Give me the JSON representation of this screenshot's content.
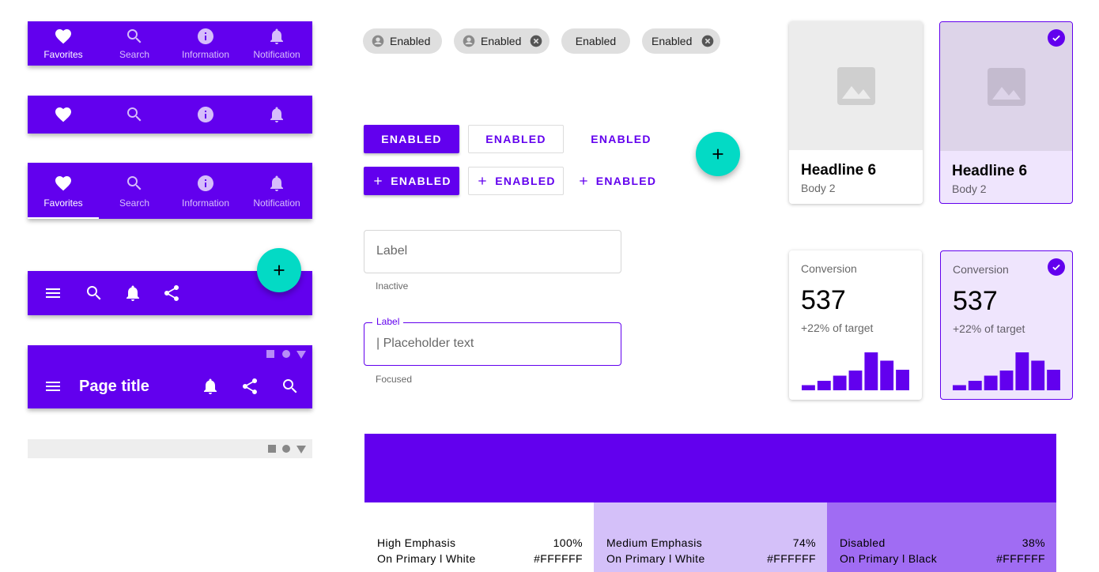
{
  "bottom_nav_labeled": {
    "items": [
      {
        "label": "Favorites",
        "icon": "heart-icon",
        "active": true
      },
      {
        "label": "Search",
        "icon": "search-icon",
        "active": false
      },
      {
        "label": "Information",
        "icon": "info-icon",
        "active": false
      },
      {
        "label": "Notification",
        "icon": "bell-icon",
        "active": false
      }
    ]
  },
  "bottom_nav_icons": {
    "items": [
      {
        "icon": "heart-icon"
      },
      {
        "icon": "search-icon"
      },
      {
        "icon": "info-icon"
      },
      {
        "icon": "bell-icon"
      }
    ]
  },
  "bottom_nav_tabs": {
    "items": [
      {
        "label": "Favorites",
        "icon": "heart-icon",
        "active": true
      },
      {
        "label": "Search",
        "icon": "search-icon",
        "active": false
      },
      {
        "label": "Information",
        "icon": "info-icon",
        "active": false
      },
      {
        "label": "Notification",
        "icon": "bell-icon",
        "active": false
      }
    ]
  },
  "bottom_app_bar": {
    "icons": [
      "menu-icon",
      "search-icon",
      "bell-icon",
      "share-icon"
    ],
    "fab_icon": "plus-icon"
  },
  "top_app_bar": {
    "title": "Page title",
    "icons": [
      "menu-icon",
      "bell-icon",
      "share-icon",
      "search-icon"
    ]
  },
  "chips": [
    {
      "label": "Enabled",
      "leading_icon": "account-icon",
      "trailing_icon": null
    },
    {
      "label": "Enabled",
      "leading_icon": "account-icon",
      "trailing_icon": "cancel-icon"
    },
    {
      "label": "Enabled",
      "leading_icon": null,
      "trailing_icon": null
    },
    {
      "label": "Enabled",
      "leading_icon": null,
      "trailing_icon": "cancel-icon"
    }
  ],
  "buttons": {
    "contained": "Enabled",
    "outlined": "Enabled",
    "text": "Enabled",
    "contained_icon": "Enabled",
    "outlined_icon": "Enabled",
    "text_icon": "Enabled"
  },
  "text_fields": {
    "inactive": {
      "label": "Label",
      "helper": "Inactive"
    },
    "focused": {
      "label": "Label",
      "value": "| Placeholder text",
      "helper": "Focused"
    }
  },
  "image_cards": [
    {
      "headline": "Headline 6",
      "body": "Body 2",
      "selected": false
    },
    {
      "headline": "Headline 6",
      "body": "Body 2",
      "selected": true
    }
  ],
  "stat_cards": [
    {
      "caption": "Conversion",
      "value": "537",
      "subtitle": "+22% of target",
      "selected": false
    },
    {
      "caption": "Conversion",
      "value": "537",
      "subtitle": "+22% of target",
      "selected": true
    }
  ],
  "chart_data": {
    "type": "bar",
    "categories": [],
    "values": [
      1.3,
      2.4,
      3.7,
      5.0,
      9.6,
      7.5,
      5.2
    ],
    "title": "",
    "ylim": [
      0,
      10
    ]
  },
  "color_swatches": {
    "primary": "#6200EE",
    "items": [
      {
        "name": "High Emphasis",
        "pct": "100%",
        "on": "On Primary l White",
        "hex": "#FFFFFF",
        "bg": "#FFFFFF",
        "fg": "#000000"
      },
      {
        "name": "Medium Emphasis",
        "pct": "74%",
        "on": "On Primary l White",
        "hex": "#FFFFFF",
        "bg": "#D4C0F9",
        "fg": "#000000"
      },
      {
        "name": "Disabled",
        "pct": "38%",
        "on": "On Primary l Black",
        "hex": "#FFFFFF",
        "bg": "#A06CF3",
        "fg": "#000000"
      }
    ]
  },
  "colors": {
    "primary": "#6200EE",
    "secondary": "#03DAC5"
  }
}
